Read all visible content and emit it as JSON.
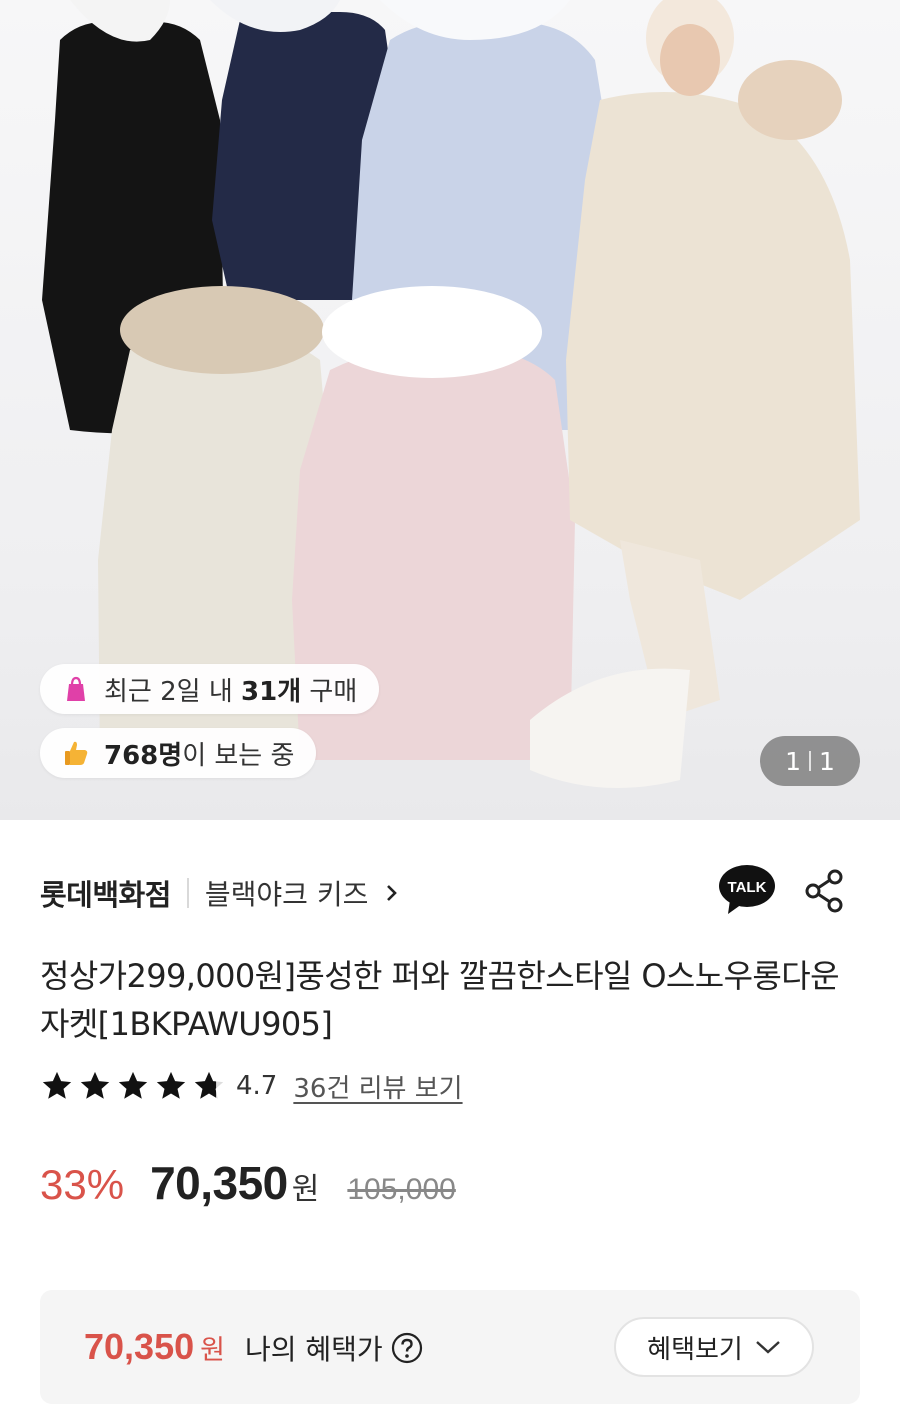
{
  "hero": {
    "chips": [
      {
        "icon": "shopping-bag-icon",
        "text_pre": "최근 2일 내 ",
        "highlight": "31개",
        "text_post": " 구매"
      },
      {
        "icon": "thumbs-up-icon",
        "text_pre": "",
        "highlight": "768명",
        "text_post": "이 보는 중"
      }
    ],
    "pager": {
      "current": "1",
      "total": "1"
    }
  },
  "seller": {
    "brand": "롯데백화점",
    "sub_brand": "블랙야크 키즈"
  },
  "product": {
    "title": "정상가299,000원]풍성한 퍼와 깔끔한스타일 O스노우롱다운자켓[1BKPAWU905]",
    "rating": {
      "score": "4.7",
      "stars": 4.7,
      "reviews_link": "36건 리뷰 보기"
    },
    "price": {
      "discount": "33%",
      "sale_price": "70,350",
      "currency": "원",
      "original_price": "105,000"
    }
  },
  "benefit": {
    "price": "70,350",
    "currency": "원",
    "label": "나의 혜택가",
    "button": "혜택보기"
  },
  "colors": {
    "accent_red": "#d9534a",
    "text_dark": "#222222",
    "benefit_bg": "#f5f5f5"
  },
  "icons": [
    "shopping-bag-icon",
    "thumbs-up-icon",
    "chevron-right-icon",
    "kakao-talk-icon",
    "share-icon",
    "star-icon",
    "question-icon",
    "chevron-down-icon"
  ]
}
